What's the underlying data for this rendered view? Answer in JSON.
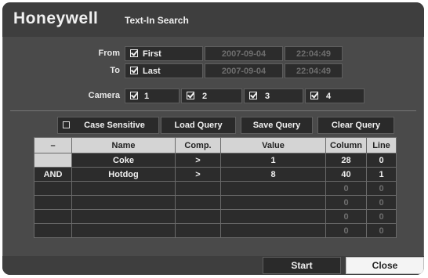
{
  "brand": "Honeywell",
  "title": "Text-In Search",
  "from": {
    "label": "From",
    "option": "First",
    "checked": true,
    "date": "2007-09-04",
    "time": "22:04:49"
  },
  "to": {
    "label": "To",
    "option": "Last",
    "checked": true,
    "date": "2007-09-04",
    "time": "22:04:49"
  },
  "camera": {
    "label": "Camera",
    "items": [
      "1",
      "2",
      "3",
      "4"
    ]
  },
  "toolbar": {
    "case_sensitive": "Case Sensitive",
    "case_sensitive_checked": false,
    "load": "Load Query",
    "save": "Save Query",
    "clear": "Clear Query"
  },
  "table": {
    "headers": [
      "–",
      "Name",
      "Comp.",
      "Value",
      "Column",
      "Line"
    ],
    "rows": [
      [
        "",
        "Coke",
        ">",
        "1",
        "28",
        "0"
      ],
      [
        "AND",
        "Hotdog",
        ">",
        "8",
        "40",
        "1"
      ],
      [
        "",
        "",
        "",
        "",
        "0",
        "0"
      ],
      [
        "",
        "",
        "",
        "",
        "0",
        "0"
      ],
      [
        "",
        "",
        "",
        "",
        "0",
        "0"
      ],
      [
        "",
        "",
        "",
        "",
        "0",
        "0"
      ]
    ]
  },
  "buttons": {
    "start": "Start",
    "close": "Close"
  },
  "colors": {
    "panel": "#4a4a4a",
    "field": "#2c2c2c",
    "header": "#d4d4d4",
    "text": "#f0f0f0",
    "dim": "#6e6e6e"
  }
}
